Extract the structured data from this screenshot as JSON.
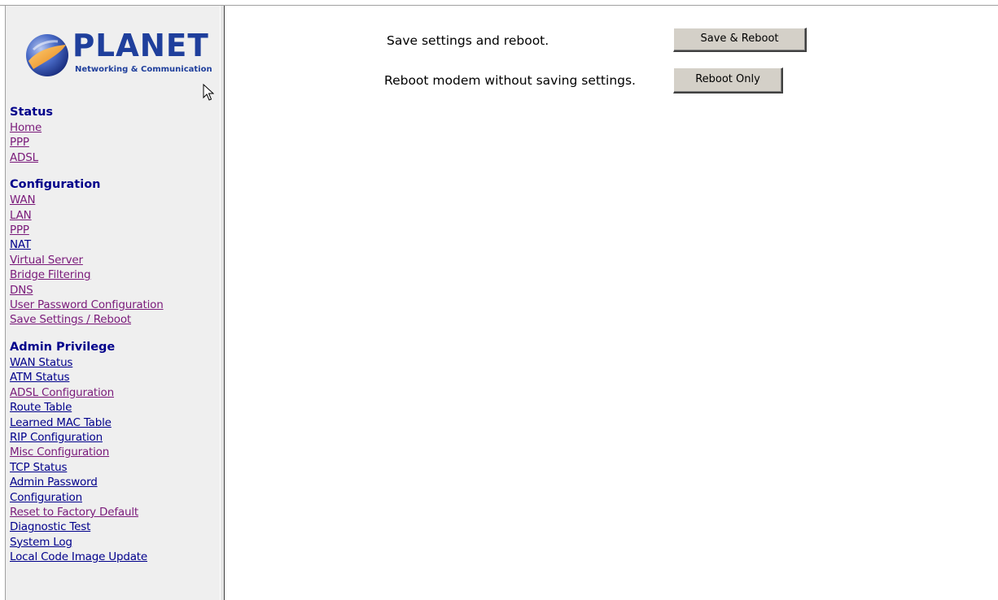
{
  "logo": {
    "brand": "PLANET",
    "tagline": "Networking & Communication"
  },
  "sidebar": {
    "sections": [
      {
        "heading": "Status",
        "links": [
          {
            "label": "Home",
            "visited": true
          },
          {
            "label": "PPP",
            "visited": true
          },
          {
            "label": "ADSL",
            "visited": true
          }
        ]
      },
      {
        "heading": "Configuration",
        "links": [
          {
            "label": "WAN",
            "visited": true
          },
          {
            "label": "LAN",
            "visited": true
          },
          {
            "label": "PPP",
            "visited": true
          },
          {
            "label": "NAT",
            "visited": false
          },
          {
            "label": "Virtual Server",
            "visited": true
          },
          {
            "label": "Bridge Filtering",
            "visited": true
          },
          {
            "label": "DNS",
            "visited": true
          },
          {
            "label": "User Password Configuration",
            "visited": true
          },
          {
            "label": "Save Settings / Reboot",
            "visited": true
          }
        ]
      },
      {
        "heading": "Admin Privilege",
        "links": [
          {
            "label": "WAN Status",
            "visited": false
          },
          {
            "label": "ATM Status",
            "visited": false
          },
          {
            "label": "ADSL Configuration",
            "visited": true
          },
          {
            "label": "Route Table",
            "visited": false
          },
          {
            "label": "Learned MAC Table",
            "visited": false
          },
          {
            "label": "RIP Configuration",
            "visited": false
          },
          {
            "label": "Misc Configuration",
            "visited": true
          },
          {
            "label": "TCP Status",
            "visited": false
          },
          {
            "label": "Admin Password",
            "visited": false
          },
          {
            "label": "Configuration",
            "visited": false
          },
          {
            "label": "Reset to Factory Default",
            "visited": true
          },
          {
            "label": "Diagnostic Test",
            "visited": false
          },
          {
            "label": "System Log",
            "visited": false
          },
          {
            "label": "Local Code Image Update",
            "visited": false
          }
        ]
      }
    ]
  },
  "main": {
    "save_row": {
      "label": "Save settings and reboot.",
      "button": "Save & Reboot"
    },
    "reboot_row": {
      "label": "Reboot modem without saving settings.",
      "button": "Reboot Only"
    }
  },
  "colors": {
    "link": "#00008b",
    "visited_link": "#7a1a7a",
    "heading": "#00008b",
    "sidebar_bg": "#efefef",
    "button_face": "#d4d0c8",
    "logo_blue": "#1f3f9c",
    "logo_orange": "#f39a1e"
  }
}
